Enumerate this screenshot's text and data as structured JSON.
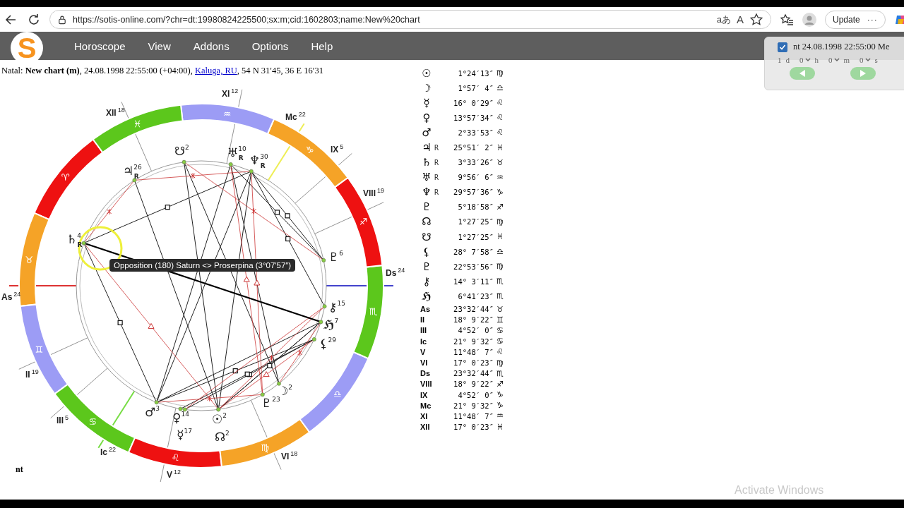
{
  "browser": {
    "url": "https://sotis-online.com/?chr=dt:19980824225500;sx:m;cid:1602803;name:New%20chart",
    "translate_icon": "aあ",
    "read_aloud_icon": "A",
    "update_button": "Update",
    "more_button": "···"
  },
  "logo": "S",
  "menu": [
    "Horoscope",
    "View",
    "Addons",
    "Options",
    "Help"
  ],
  "header": {
    "text": "Natal: **New chart (m)**, 24.08.1998 22:55:00 (+04:00),",
    "link": "Kaluga, RU",
    "coords": ", 54 N 31′45, 36 E 16′31"
  },
  "chart": {
    "signs": [
      {
        "glyph": "♈︎",
        "color": "#ee1111"
      },
      {
        "glyph": "♉︎",
        "color": "#f5a327"
      },
      {
        "glyph": "♊︎",
        "color": "#9c9cf5"
      },
      {
        "glyph": "♋︎",
        "color": "#5cc71c"
      },
      {
        "glyph": "♌︎",
        "color": "#ee1111"
      },
      {
        "glyph": "♍︎",
        "color": "#f5a327"
      },
      {
        "glyph": "♎︎",
        "color": "#9c9cf5"
      },
      {
        "glyph": "♏︎",
        "color": "#5cc71c"
      },
      {
        "glyph": "♐︎",
        "color": "#ee1111"
      },
      {
        "glyph": "♑︎",
        "color": "#f5a327"
      },
      {
        "glyph": "♒︎",
        "color": "#9c9cf5"
      },
      {
        "glyph": "♓︎",
        "color": "#5cc71c"
      }
    ],
    "houses": [
      {
        "label": "As",
        "degree": "24"
      },
      {
        "label": "II",
        "degree": "19"
      },
      {
        "label": "III",
        "degree": "5"
      },
      {
        "label": "Ic",
        "degree": "22"
      },
      {
        "label": "V",
        "degree": "12"
      },
      {
        "label": "VI",
        "degree": "18"
      },
      {
        "label": "Ds",
        "degree": "24"
      },
      {
        "label": "VIII",
        "degree": "19"
      },
      {
        "label": "IX",
        "degree": "5"
      },
      {
        "label": "Mc",
        "degree": "22"
      },
      {
        "label": "XI",
        "degree": "12"
      },
      {
        "label": "XII",
        "degree": "18"
      }
    ],
    "planets": [
      {
        "glyph": "☉",
        "degree": "2"
      },
      {
        "glyph": "☽",
        "degree": "2"
      },
      {
        "glyph": "♀",
        "degree": "14"
      },
      {
        "glyph": "☿",
        "degree": "17"
      },
      {
        "glyph": "♂",
        "degree": "3"
      },
      {
        "glyph": "♃",
        "degree": "26",
        "flag": "R"
      },
      {
        "glyph": "♄",
        "degree": "4",
        "flag": "R"
      },
      {
        "glyph": "♅",
        "degree": "10",
        "flag": "R"
      },
      {
        "glyph": "♆",
        "degree": "30",
        "flag": "R"
      },
      {
        "glyph": "♇",
        "degree": "6"
      },
      {
        "glyph": "☊",
        "degree": "2"
      },
      {
        "glyph": "☋",
        "degree": "2"
      },
      {
        "glyph": "⚸",
        "degree": "29"
      },
      {
        "glyph": "♇",
        "degree": "23"
      },
      {
        "glyph": "⚷",
        "degree": "15"
      },
      {
        "glyph": "ℌ",
        "degree": "7"
      }
    ],
    "tooltip": "Opposition (180) Saturn <> Proserpina (3°07′57″)",
    "footer_label": "nt"
  },
  "positions": [
    {
      "kind": "planet",
      "glyph": "☉",
      "position": "1°24′13″",
      "sign": "♍︎"
    },
    {
      "kind": "planet",
      "glyph": "☽",
      "position": "1°57′ 4″",
      "sign": "♎︎"
    },
    {
      "kind": "planet",
      "glyph": "☿",
      "position": "16° 0′29″",
      "sign": "♌︎"
    },
    {
      "kind": "planet",
      "glyph": "♀",
      "position": "13°57′34″",
      "sign": "♌︎"
    },
    {
      "kind": "planet",
      "glyph": "♂",
      "position": "2°33′53″",
      "sign": "♌︎"
    },
    {
      "kind": "planet",
      "glyph": "♃",
      "flag": "R",
      "position": "25°51′ 2″",
      "sign": "♓︎"
    },
    {
      "kind": "planet",
      "glyph": "♄",
      "flag": "R",
      "position": "3°33′26″",
      "sign": "♉︎"
    },
    {
      "kind": "planet",
      "glyph": "♅",
      "flag": "R",
      "position": "9°56′ 6″",
      "sign": "♒︎"
    },
    {
      "kind": "planet",
      "glyph": "♆",
      "flag": "R",
      "position": "29°57′36″",
      "sign": "♑︎"
    },
    {
      "kind": "planet",
      "glyph": "♇",
      "position": "5°18′58″",
      "sign": "♐︎"
    },
    {
      "kind": "planet",
      "glyph": "☊",
      "position": "1°27′25″",
      "sign": "♍︎"
    },
    {
      "kind": "planet",
      "glyph": "☋",
      "position": "1°27′25″",
      "sign": "♓︎"
    },
    {
      "kind": "planet",
      "glyph": "⚸",
      "position": "28° 7′58″",
      "sign": "♎︎"
    },
    {
      "kind": "planet",
      "glyph": "♇",
      "position": "22°53′56″",
      "sign": "♍︎"
    },
    {
      "kind": "planet",
      "glyph": "⚷",
      "position": "14° 3′11″",
      "sign": "♏︎"
    },
    {
      "kind": "planet",
      "glyph": "ℌ",
      "position": "6°41′23″",
      "sign": "♏︎"
    },
    {
      "kind": "house",
      "glyph": "As",
      "position": "23°32′44″",
      "sign": "♉︎"
    },
    {
      "kind": "house",
      "glyph": "II",
      "position": "18° 9′22″",
      "sign": "♊︎"
    },
    {
      "kind": "house",
      "glyph": "III",
      "position": "4°52′ 0″",
      "sign": "♋︎"
    },
    {
      "kind": "house",
      "glyph": "Ic",
      "position": "21° 9′32″",
      "sign": "♋︎"
    },
    {
      "kind": "house",
      "glyph": "V",
      "position": "11°48′ 7″",
      "sign": "♌︎"
    },
    {
      "kind": "house",
      "glyph": "VI",
      "position": "17° 0′23″",
      "sign": "♍︎"
    },
    {
      "kind": "house",
      "glyph": "Ds",
      "position": "23°32′44″",
      "sign": "♏︎"
    },
    {
      "kind": "house",
      "glyph": "VIII",
      "position": "18° 9′22″",
      "sign": "♐︎"
    },
    {
      "kind": "house",
      "glyph": "IX",
      "position": "4°52′ 0″",
      "sign": "♑︎"
    },
    {
      "kind": "house",
      "glyph": "Mc",
      "position": "21° 9′32″",
      "sign": "♑︎"
    },
    {
      "kind": "house",
      "glyph": "XI",
      "position": "11°48′ 7″",
      "sign": "♒︎"
    },
    {
      "kind": "house",
      "glyph": "XII",
      "position": "17° 0′23″",
      "sign": "♓︎"
    }
  ],
  "time_panel": {
    "checked": true,
    "label": "nt 24.08.1998 22:55:00 Me",
    "step": "1",
    "step_unit": "d",
    "selects": [
      {
        "value": "0",
        "unit": "h"
      },
      {
        "value": "0",
        "unit": "m"
      },
      {
        "value": "0",
        "unit": "s"
      }
    ]
  },
  "os_overlay": "Activate Windows"
}
